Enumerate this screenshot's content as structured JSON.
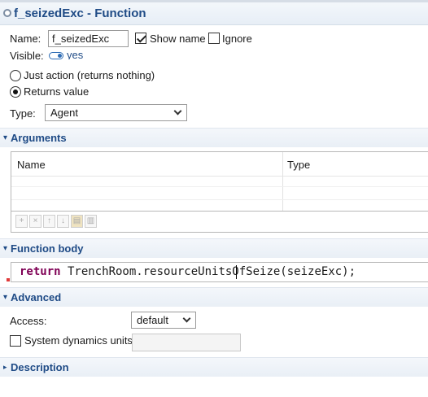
{
  "header": {
    "title": "f_seizedExc - Function",
    "icon": "function-icon"
  },
  "general": {
    "name_label": "Name:",
    "name_value": "f_seizedExc",
    "show_name_label": "Show name",
    "show_name_checked": true,
    "ignore_label": "Ignore",
    "ignore_checked": false,
    "visible_label": "Visible:",
    "visible_value": "yes",
    "just_action_label": "Just action (returns nothing)",
    "returns_value_label": "Returns value",
    "selected_mode": "Returns value",
    "type_label": "Type:",
    "type_value": "Agent"
  },
  "arguments": {
    "section_title": "Arguments",
    "columns": [
      "Name",
      "Type"
    ],
    "rows": [],
    "toolbar_icons": [
      "add-icon",
      "remove-icon",
      "move-up-icon",
      "move-down-icon",
      "copy-icon",
      "paste-icon"
    ]
  },
  "function_body": {
    "section_title": "Function body",
    "code_keyword": "return",
    "code_rest": " TrenchRoom.resourceUnitsOfSeize(seizeExc);"
  },
  "advanced": {
    "section_title": "Advanced",
    "access_label": "Access:",
    "access_value": "default",
    "system_dynamics_label": "System dynamics units:",
    "system_dynamics_checked": false
  },
  "description": {
    "section_title": "Description"
  }
}
